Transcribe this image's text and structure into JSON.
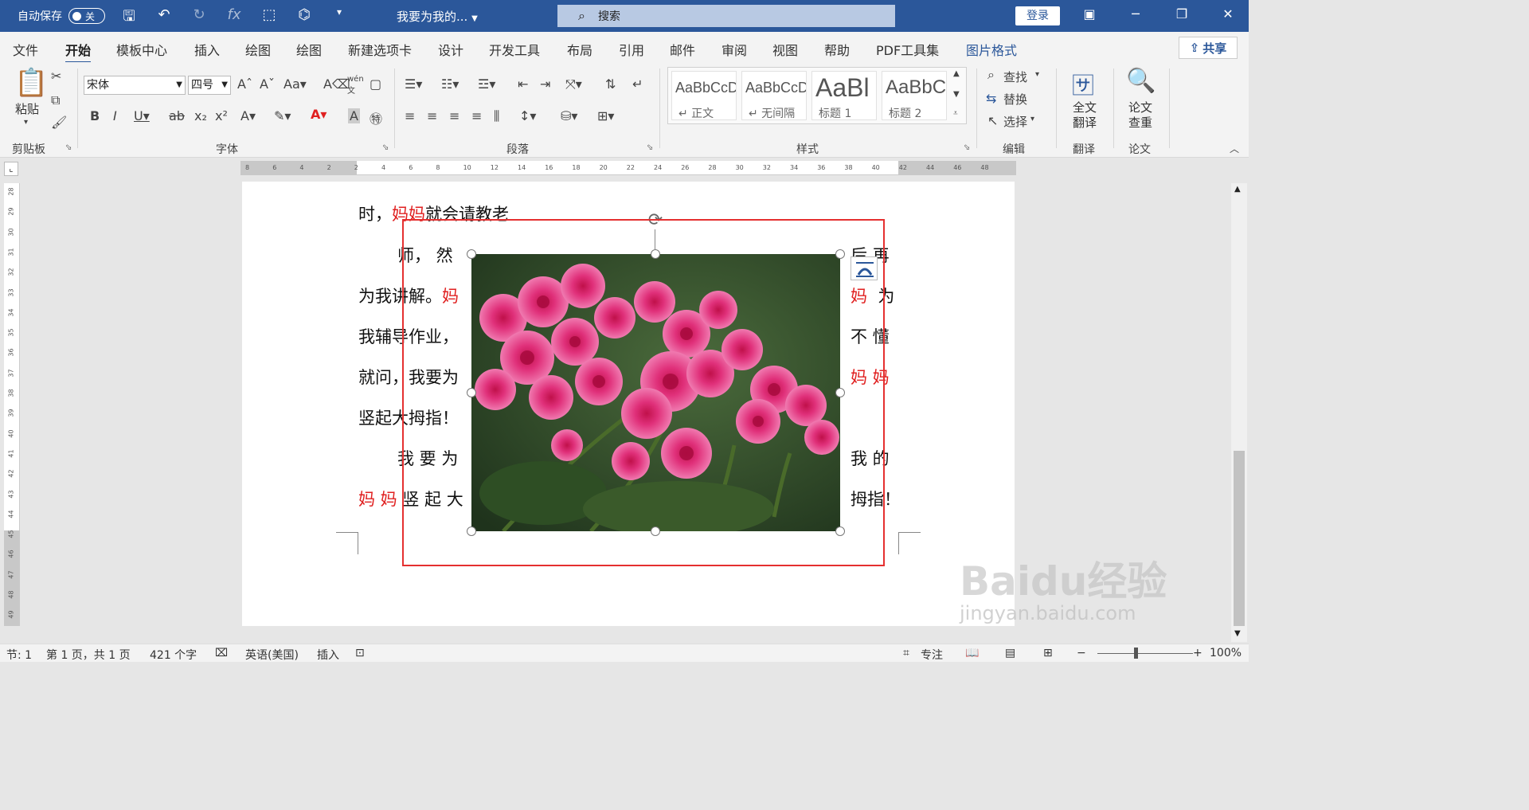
{
  "titlebar": {
    "autosave_label": "自动保存",
    "autosave_state": "关",
    "doc_title": "我要为我的...",
    "search_placeholder": "搜索",
    "login_label": "登录",
    "accent": "#2b579a"
  },
  "tabs": [
    "文件",
    "开始",
    "模板中心",
    "插入",
    "绘图",
    "绘图",
    "新建选项卡",
    "设计",
    "开发工具",
    "布局",
    "引用",
    "邮件",
    "审阅",
    "视图",
    "帮助",
    "PDF工具集",
    "图片格式"
  ],
  "active_tab": "开始",
  "share_label": "共享",
  "ribbon": {
    "clipboard": {
      "paste": "粘贴",
      "label": "剪贴板"
    },
    "font": {
      "name": "宋体",
      "size": "四号",
      "label": "字体"
    },
    "paragraph": {
      "label": "段落"
    },
    "styles": {
      "label": "样式",
      "items": [
        {
          "preview": "AaBbCcDc",
          "name": "↵ 正文"
        },
        {
          "preview": "AaBbCcDc",
          "name": "↵ 无间隔"
        },
        {
          "preview": "AaBl",
          "name": "标题 1"
        },
        {
          "preview": "AaBbC",
          "name": "标题 2"
        }
      ]
    },
    "editing": {
      "find": "查找",
      "replace": "替换",
      "select": "选择",
      "label": "编辑"
    },
    "translate": {
      "full": "全文",
      "full2": "翻译",
      "label": "翻译"
    },
    "paper": {
      "check": "论文",
      "check2": "查重",
      "label": "论文"
    }
  },
  "ruler": {
    "h_ticks": [
      "8",
      "6",
      "4",
      "2",
      "2",
      "4",
      "6",
      "8",
      "10",
      "12",
      "14",
      "16",
      "18",
      "20",
      "22",
      "24",
      "26",
      "28",
      "30",
      "32",
      "34",
      "36",
      "38",
      "40",
      "42",
      "44",
      "46",
      "48"
    ],
    "v_ticks": [
      "28",
      "29",
      "30",
      "31",
      "32",
      "33",
      "34",
      "35",
      "36",
      "37",
      "38",
      "39",
      "40",
      "41",
      "42",
      "43",
      "44",
      "45",
      "46",
      "47",
      "48",
      "49"
    ]
  },
  "document": {
    "line0_a": "时，",
    "line0_b": "妈妈",
    "line0_c": "就会请教老",
    "left": [
      "师，  然",
      "为我讲解。",
      "我辅导作业，",
      "就问，我要为",
      "竖起大拇指！",
      "我 要 为",
      "竖 起 大"
    ],
    "left_red1": "妈",
    "left_red2": "妈 妈",
    "right": [
      "后  再",
      "为",
      "不  懂",
      "",
      "",
      "我  的",
      "拇指！"
    ],
    "right_red1": "妈",
    "right_red2": "妈  妈"
  },
  "statusbar": {
    "section": "节: 1",
    "page": "第 1 页，共 1 页",
    "words": "421 个字",
    "language": "英语(美国)",
    "mode": "插入",
    "focus": "专注",
    "zoom": "100%"
  },
  "watermark": {
    "line1": "Baidu经验",
    "line2": "jingyan.baidu.com"
  }
}
